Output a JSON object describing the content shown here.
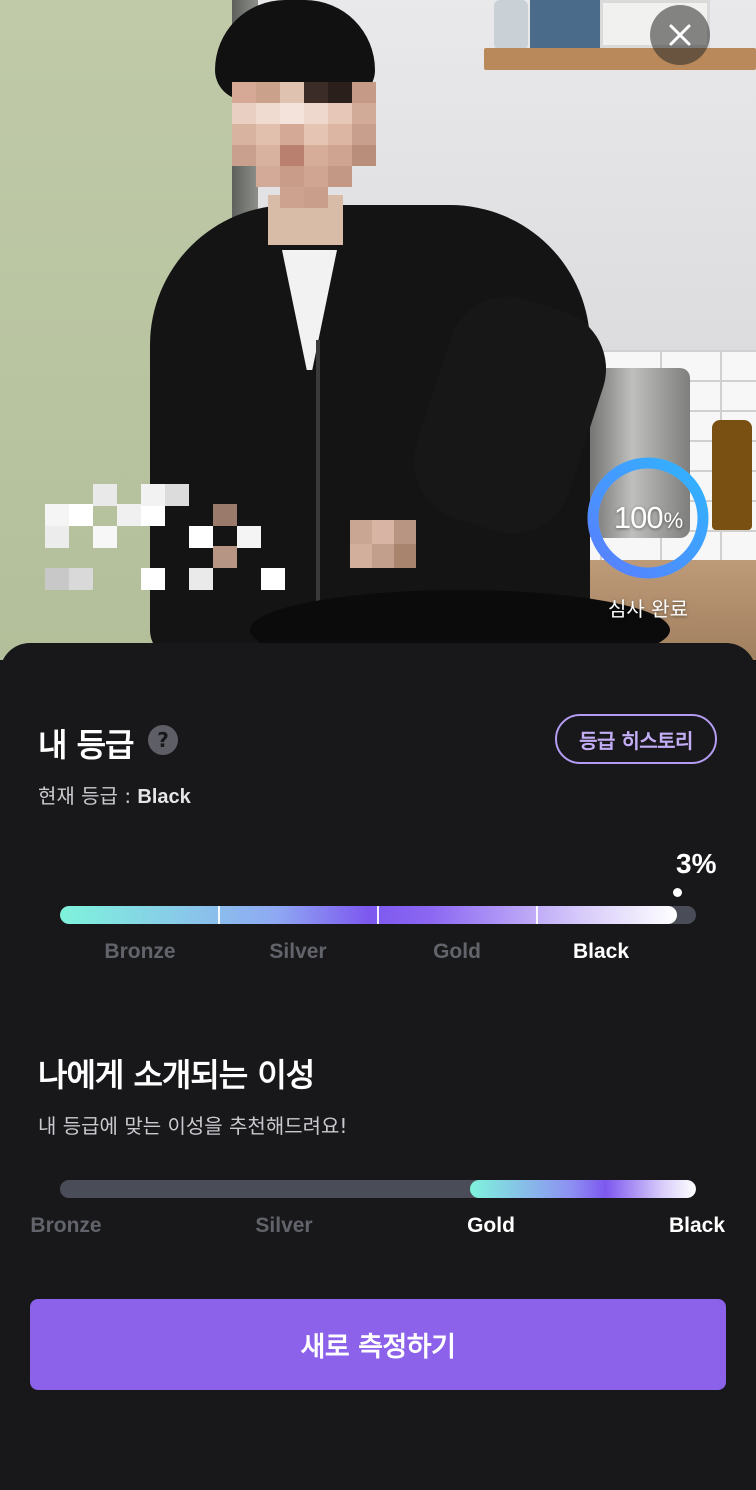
{
  "photo": {
    "review_percent": 100,
    "review_percent_number": "100",
    "review_percent_sign": "%",
    "review_status": "심사 완료",
    "ring_color": "#3aa0ff"
  },
  "grade_section": {
    "title": "내 등급",
    "help_glyph": "?",
    "history_button": "등급 히스토리",
    "current_label": "현재 등급 : ",
    "current_value": "Black",
    "top_percent_label": "3%",
    "progress_fraction": 0.97,
    "ticks": [
      "Bronze",
      "Silver",
      "Gold",
      "Black"
    ],
    "active_tick": "Black"
  },
  "match_section": {
    "title": "나에게 소개되는 이성",
    "subtitle": "내 등급에 맞는 이성을 추천해드려요!",
    "range_start_fraction": 0.645,
    "range_end_fraction": 1.0,
    "ticks": [
      "Bronze",
      "Silver",
      "Gold",
      "Black"
    ],
    "active_ticks": [
      "Gold",
      "Black"
    ]
  },
  "cta": {
    "label": "새로 측정하기",
    "color": "#8b62e9"
  },
  "colors": {
    "accent_purple": "#8b62e9",
    "history_border": "#b49cf2",
    "track": "#4a4d57"
  }
}
